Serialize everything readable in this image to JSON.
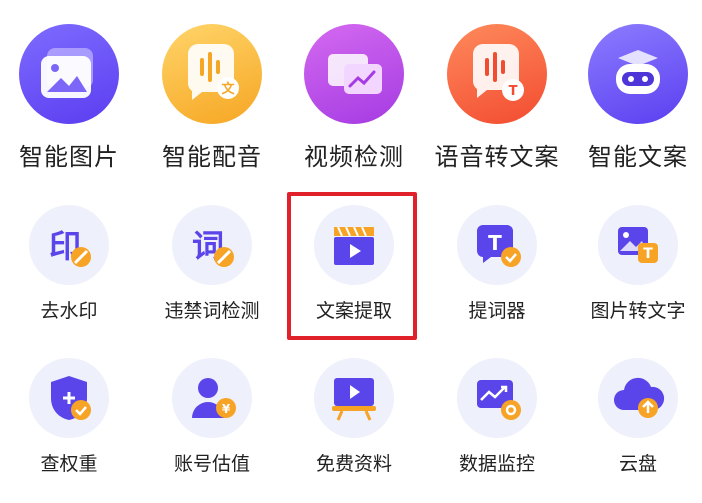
{
  "colors": {
    "highlight": "#e0202a",
    "icon_bg": "#eef0fb",
    "purple": "#6a4cf5",
    "orange": "#f7a326"
  },
  "row1": [
    {
      "label": "智能图片",
      "icon": "image-icon"
    },
    {
      "label": "智能配音",
      "icon": "voice-dubbing-icon"
    },
    {
      "label": "视频检测",
      "icon": "video-check-icon"
    },
    {
      "label": "语音转文案",
      "icon": "speech-to-text-icon"
    },
    {
      "label": "智能文案",
      "icon": "ai-robot-icon"
    }
  ],
  "row2": [
    {
      "label": "去水印",
      "icon": "remove-watermark-icon"
    },
    {
      "label": "违禁词检测",
      "icon": "forbidden-word-icon"
    },
    {
      "label": "文案提取",
      "icon": "clapperboard-icon"
    },
    {
      "label": "提词器",
      "icon": "teleprompter-icon"
    },
    {
      "label": "图片转文字",
      "icon": "image-to-text-icon"
    }
  ],
  "row3": [
    {
      "label": "查权重",
      "icon": "shield-plus-icon"
    },
    {
      "label": "账号估值",
      "icon": "account-valuation-icon"
    },
    {
      "label": "免费资料",
      "icon": "presentation-icon"
    },
    {
      "label": "数据监控",
      "icon": "chart-monitor-icon"
    },
    {
      "label": "云盘",
      "icon": "cloud-upload-icon"
    }
  ]
}
